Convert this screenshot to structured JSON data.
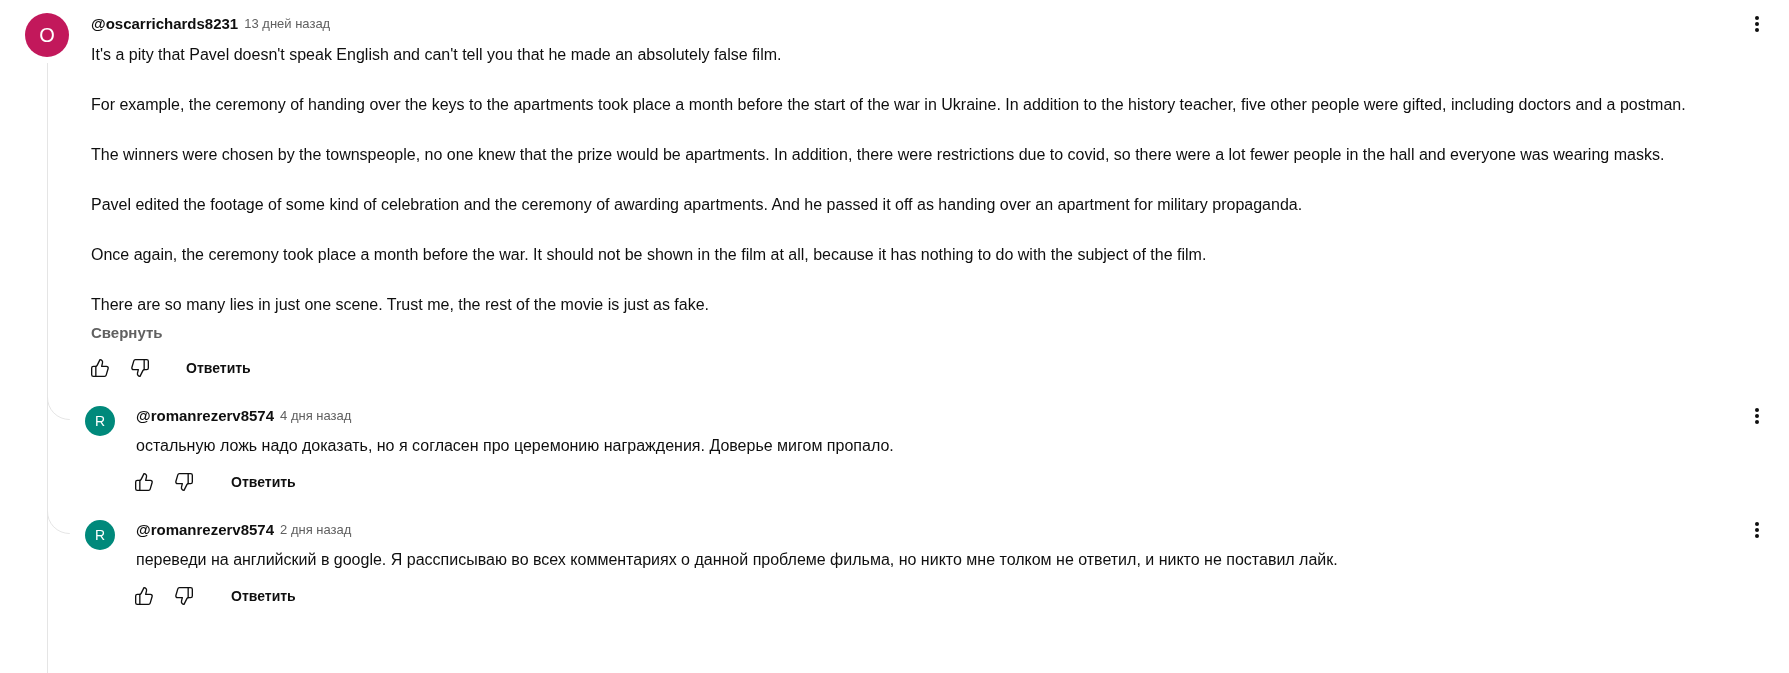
{
  "comment": {
    "avatar": {
      "letter": "O",
      "color": "#c2185b"
    },
    "author": "@oscarrichards8231",
    "time": "13 дней назад",
    "paragraphs": [
      "It's a pity that Pavel doesn't speak English and can't tell you that he made an absolutely false film.",
      "For example, the ceremony of handing over the keys to the apartments took place a month before the start of the war in Ukraine. In addition to the history teacher, five other people were gifted, including doctors and a postman.",
      "The winners were chosen by the townspeople, no one knew that the prize would be apartments. In addition, there were restrictions due to covid, so there were a lot fewer people in the hall and everyone was wearing masks.",
      "Pavel edited the footage of some kind of celebration and the ceremony of awarding apartments. And he passed it off as handing over an apartment for military propaganda.",
      "Once again, the ceremony took place a month before the war. It should not be shown in the film at all, because it has nothing to do with the subject of the film.",
      "There are so many lies in just one scene. Trust me, the rest of the movie is just as fake."
    ],
    "collapse_link": "Свернуть",
    "reply_button": "Ответить"
  },
  "replies": [
    {
      "avatar": {
        "letter": "R",
        "color": "#00897b"
      },
      "author": "@romanrezerv8574",
      "time": "4 дня назад",
      "text": "остальную ложь надо доказать, но я согласен про церемонию награждения. Доверье мигом пропало.",
      "reply_button": "Ответить"
    },
    {
      "avatar": {
        "letter": "R",
        "color": "#00897b"
      },
      "author": "@romanrezerv8574",
      "time": "2 дня назад",
      "text": "переведи на английский в google. Я рассписываю во всех комментариях о данной проблеме фильма, но никто мне толком не ответил, и никто не поставил лайк.",
      "reply_button": "Ответить"
    }
  ]
}
